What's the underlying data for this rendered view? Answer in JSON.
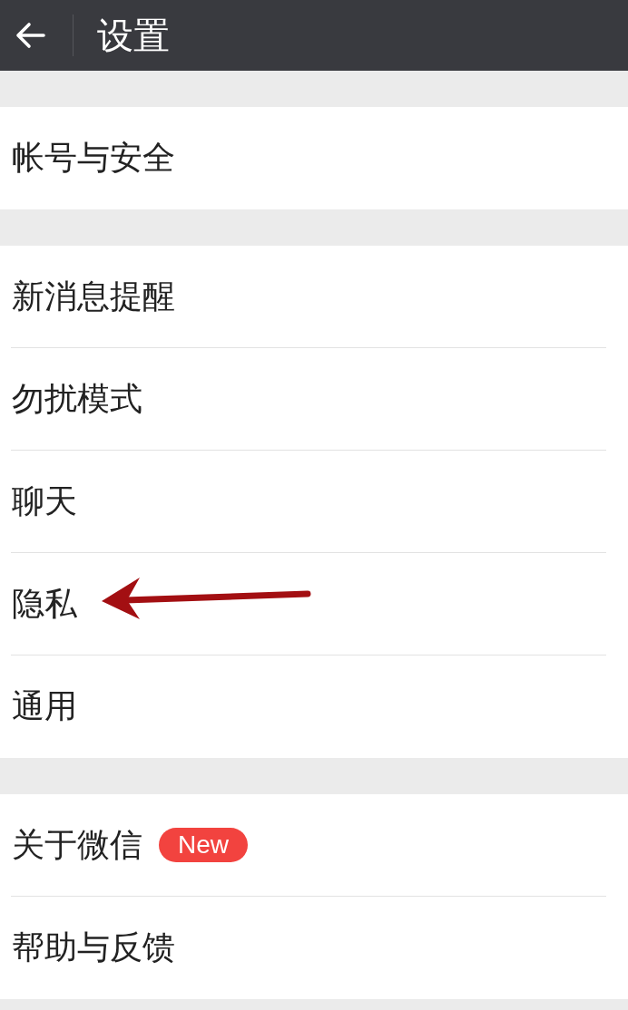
{
  "header": {
    "title": "设置"
  },
  "groups": [
    {
      "items": [
        {
          "label": "帐号与安全",
          "pointed": false
        }
      ]
    },
    {
      "items": [
        {
          "label": "新消息提醒",
          "pointed": false
        },
        {
          "label": "勿扰模式",
          "pointed": false
        },
        {
          "label": "聊天",
          "pointed": false
        },
        {
          "label": "隐私",
          "pointed": true
        },
        {
          "label": "通用",
          "pointed": false
        }
      ]
    },
    {
      "items": [
        {
          "label": "关于微信",
          "badge": "New",
          "pointed": false
        },
        {
          "label": "帮助与反馈",
          "pointed": false
        }
      ]
    }
  ]
}
